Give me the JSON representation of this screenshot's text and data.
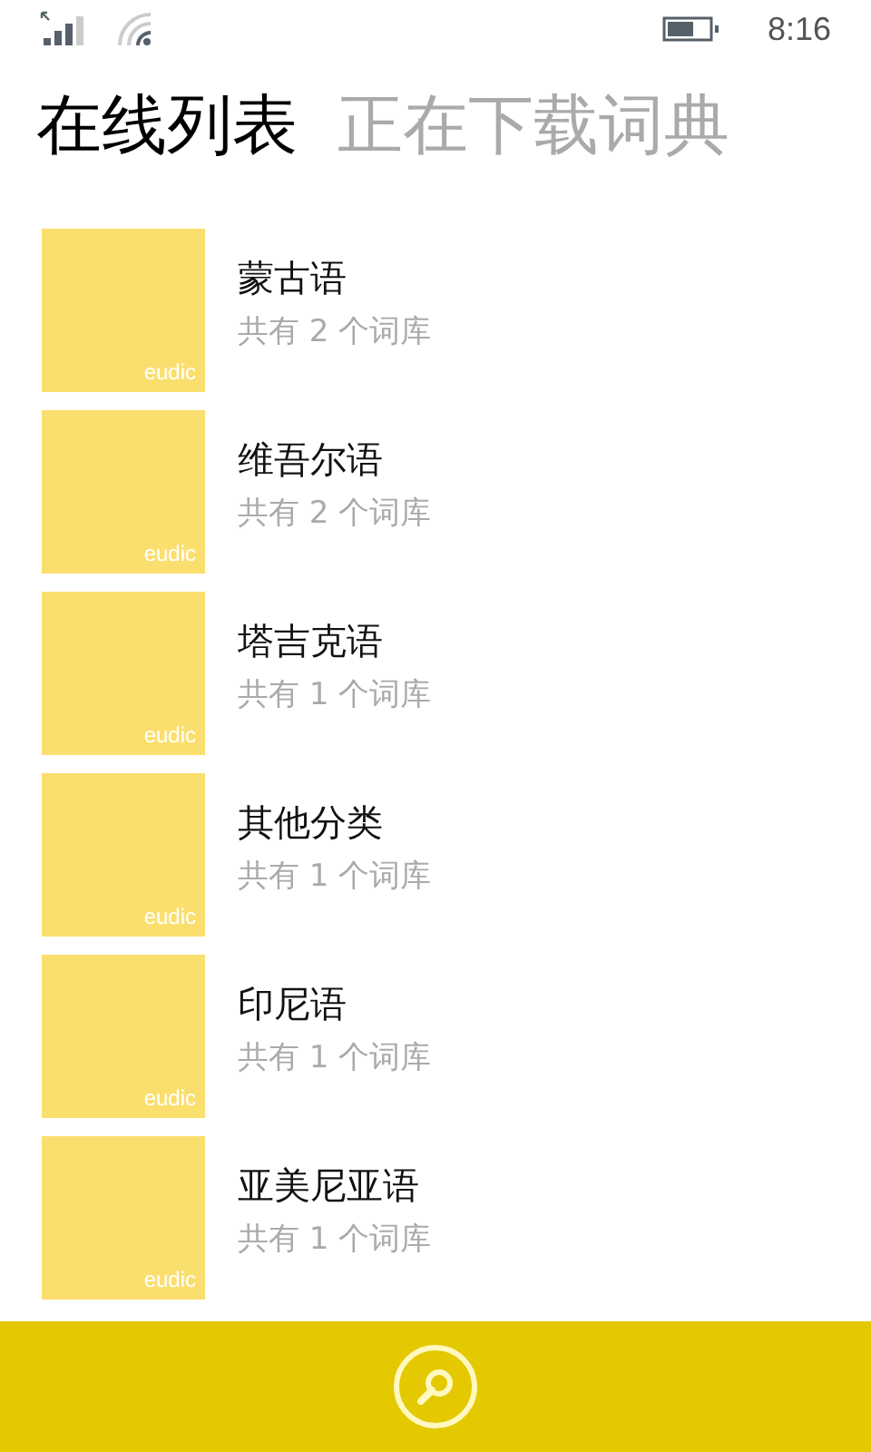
{
  "status_bar": {
    "time": "8:16"
  },
  "tabs": [
    {
      "label": "在线列表",
      "selected": true
    },
    {
      "label": "正在下载词典",
      "selected": false
    }
  ],
  "items": [
    {
      "name": "蒙古语",
      "tile_label": "eudic",
      "count": "共有 2 个词库"
    },
    {
      "name": "维吾尔语",
      "tile_label": "eudic",
      "count": "共有 2 个词库"
    },
    {
      "name": "塔吉克语",
      "tile_label": "eudic",
      "count": "共有 1 个词库"
    },
    {
      "name": "其他分类",
      "tile_label": "eudic",
      "count": "共有 1 个词库"
    },
    {
      "name": "印尼语",
      "tile_label": "eudic",
      "count": "共有 1 个词库"
    },
    {
      "name": "亚美尼亚语",
      "tile_label": "eudic",
      "count": "共有 1 个词库"
    }
  ]
}
